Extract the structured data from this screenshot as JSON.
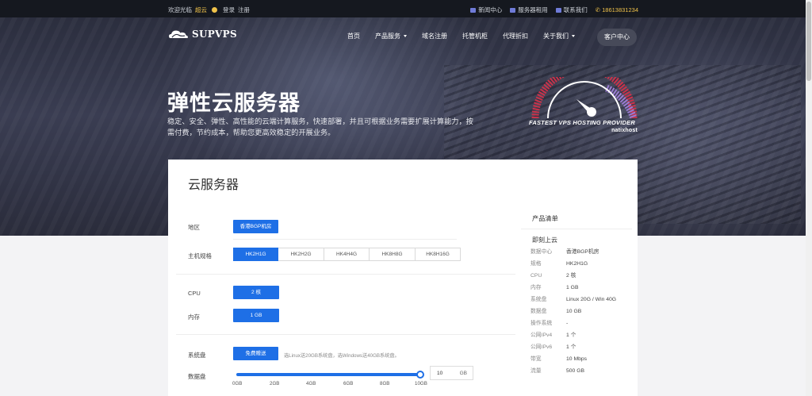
{
  "topbar": {
    "welcome": "欢迎光临",
    "brand": "超云",
    "login": "登录",
    "register": "注册",
    "links": [
      "新闻中心",
      "服务器租用",
      "联系我们"
    ],
    "phone": "18613831234"
  },
  "header": {
    "logo_text": "SUPVPS",
    "nav": [
      {
        "label": "首页",
        "dropdown": false
      },
      {
        "label": "产品服务",
        "dropdown": true
      },
      {
        "label": "域名注册",
        "dropdown": false
      },
      {
        "label": "托管机柜",
        "dropdown": false
      },
      {
        "label": "代理折扣",
        "dropdown": false
      },
      {
        "label": "关于我们",
        "dropdown": true
      }
    ],
    "user_center": "客户中心"
  },
  "hero": {
    "title": "弹性云服务器",
    "subtitle": "稳定、安全、弹性、高性能的云端计算服务，快速部署，并且可根据业务需要扩展计算能力，按需付费，节约成本，帮助您更高效稳定的开展业务。",
    "badge_line1": "FASTEST VPS HOSTING PROVIDER",
    "badge_line2": "natixhost"
  },
  "card": {
    "title": "云服务器",
    "region": {
      "label": "地区",
      "option": "香港BGP机房"
    },
    "spec": {
      "label": "主机规格",
      "options": [
        "HK2H1G",
        "HK2H2G",
        "HK4H4G",
        "HK8H8G",
        "HK8H16G"
      ],
      "selected": 0
    },
    "cpu": {
      "label": "CPU",
      "value": "2 核"
    },
    "memory": {
      "label": "内存",
      "value": "1 GB"
    },
    "system_disk": {
      "label": "系统盘",
      "button": "免费赠送",
      "hint": "选Linux送20GB系统盘，选Windows送40GB系统盘。"
    },
    "data_disk": {
      "label": "数据盘",
      "ticks": [
        "0GB",
        "2GB",
        "4GB",
        "6GB",
        "8GB",
        "10GB"
      ],
      "value": "10",
      "unit": "GB",
      "slider_fraction": 1.0
    }
  },
  "sidebar": {
    "title": "产品清单",
    "subtitle": "即刻上云",
    "items": [
      {
        "k": "数据中心",
        "v": "香港BGP机房"
      },
      {
        "k": "规格",
        "v": "HK2H1G"
      },
      {
        "k": "CPU",
        "v": "2 核"
      },
      {
        "k": "内存",
        "v": "1 GB"
      },
      {
        "k": "系统盘",
        "v": "Linux 20G / Win 40G"
      },
      {
        "k": "数据盘",
        "v": "10 GB"
      },
      {
        "k": "操作系统",
        "v": "-"
      },
      {
        "k": "公网IPv4",
        "v": "1 个"
      },
      {
        "k": "公网IPv6",
        "v": "1 个"
      },
      {
        "k": "带宽",
        "v": "10 Mbps"
      },
      {
        "k": "流量",
        "v": "500 GB"
      }
    ]
  },
  "colors": {
    "accent": "#1e6fe6",
    "topbar_bg": "#15181f",
    "highlight": "#f0c24a"
  }
}
